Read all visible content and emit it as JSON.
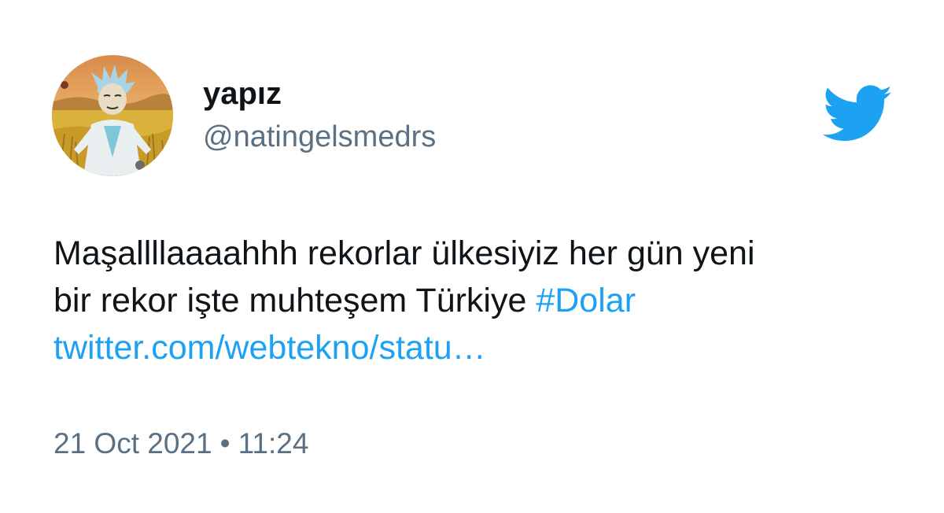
{
  "author": {
    "display_name": "yapız",
    "handle": "@natingelsmedrs",
    "avatar_icon": "cartoon-scientist-in-wheat-field-avatar"
  },
  "logo_icon": "twitter-bird-icon",
  "tweet": {
    "text_line1": "Maşallllaaaahhh rekorlar ülkesiyiz her gün yeni",
    "text_line2_prefix": "bir rekor işte muhteşem Türkiye ",
    "hashtag": "#Dolar",
    "link": "twitter.com/webtekno/statu…"
  },
  "meta": {
    "date": "21 Oct 2021",
    "separator": "•",
    "time": "11:24"
  },
  "colors": {
    "accent": "#1da1f2",
    "text": "#0f1419",
    "secondary": "#5b7083",
    "background": "#ffffff"
  }
}
